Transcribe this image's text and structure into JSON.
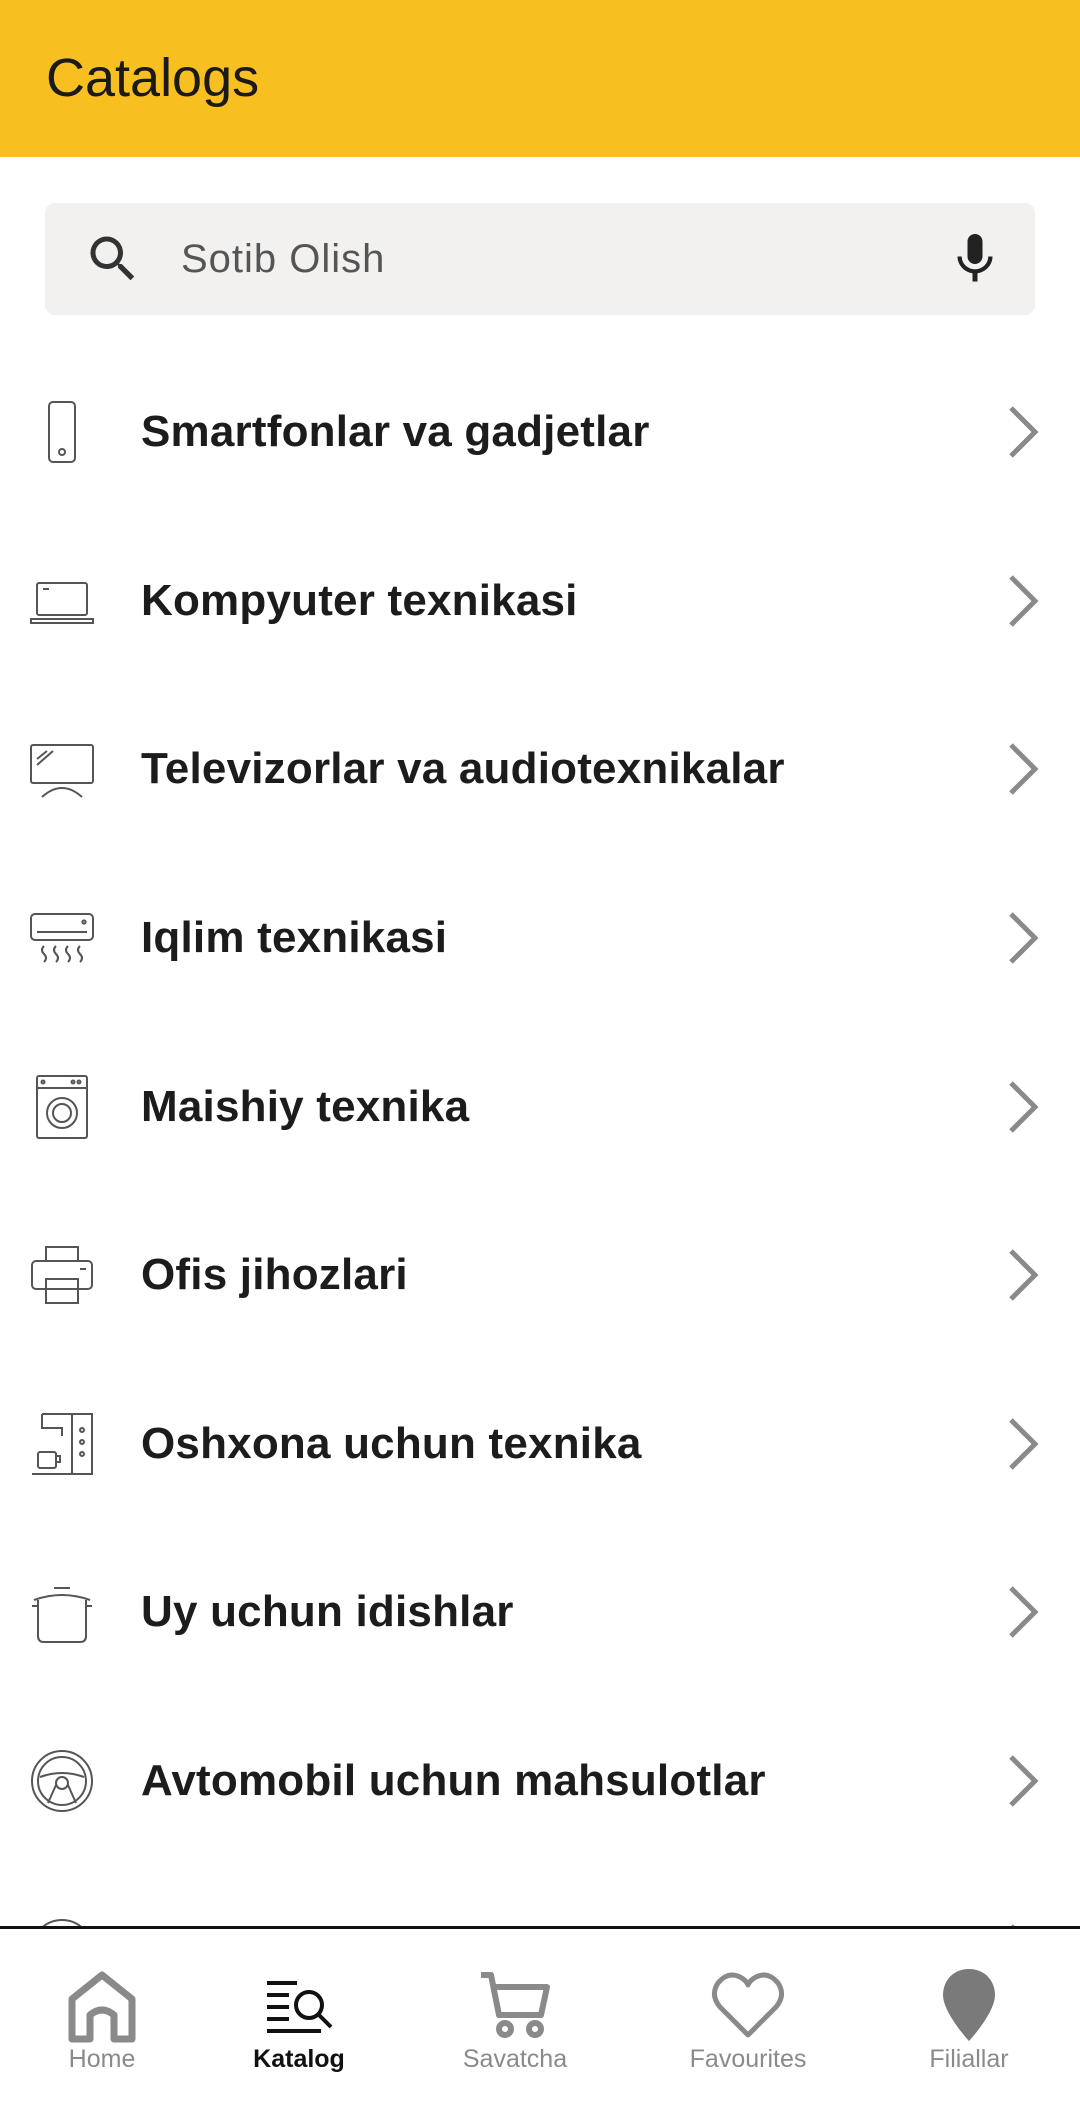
{
  "header": {
    "title": "Catalogs",
    "background": "#F8BF20"
  },
  "search": {
    "placeholder": "Sotib Olish",
    "value": ""
  },
  "categories": [
    {
      "label": "Smartfonlar va gadjetlar",
      "icon": "smartphone-icon"
    },
    {
      "label": "Kompyuter texnikasi",
      "icon": "laptop-icon"
    },
    {
      "label": "Televizorlar va audiotexnikalar",
      "icon": "tv-icon"
    },
    {
      "label": "Iqlim texnikasi",
      "icon": "air-conditioner-icon"
    },
    {
      "label": "Maishiy texnika",
      "icon": "washing-machine-icon"
    },
    {
      "label": "Ofis jihozlari",
      "icon": "printer-icon"
    },
    {
      "label": "Oshxona uchun texnika",
      "icon": "coffee-machine-icon"
    },
    {
      "label": "Uy uchun idishlar",
      "icon": "cooking-pot-icon"
    },
    {
      "label": "Avtomobil uchun mahsulotlar",
      "icon": "steering-wheel-icon"
    }
  ],
  "bottom_nav": [
    {
      "label": "Home",
      "icon": "home-icon",
      "active": false
    },
    {
      "label": "Katalog",
      "icon": "catalog-search-icon",
      "active": true
    },
    {
      "label": "Savatcha",
      "icon": "cart-icon",
      "active": false
    },
    {
      "label": "Favourites",
      "icon": "heart-icon",
      "active": false
    },
    {
      "label": "Filiallar",
      "icon": "location-pin-icon",
      "active": false
    }
  ]
}
